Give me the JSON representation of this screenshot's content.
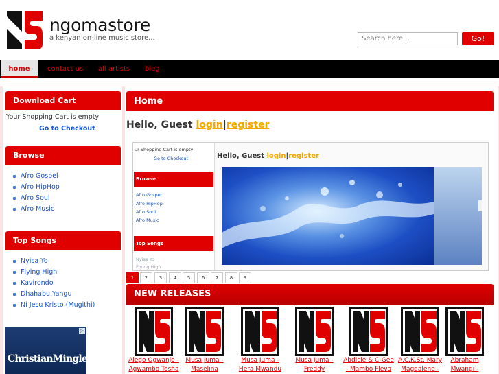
{
  "header": {
    "site_title": "ngomastore",
    "tagline": "a kenyan on-line music store...",
    "search_placeholder": "Search here...",
    "search_button": "Go!"
  },
  "nav": {
    "items": [
      "home",
      "contact us",
      "all artists",
      "blog"
    ],
    "active": "home"
  },
  "sidebar": {
    "cart": {
      "title": "Download Cart",
      "empty_text": "Your Shopping Cart is empty",
      "checkout_link": "Go to Checkout"
    },
    "browse": {
      "title": "Browse",
      "items": [
        "Afro Gospel",
        "Afro HipHop",
        "Afro Soul",
        "Afro Music"
      ]
    },
    "top_songs": {
      "title": "Top Songs",
      "items": [
        "Nyisa Yo",
        "Flying High",
        "Kavirondo",
        "Dhahabu Yangu",
        "Ni Jesu Kristo (Mugithi)"
      ]
    },
    "ad": {
      "text": "ChristianMingle",
      "badge": "▷"
    }
  },
  "main": {
    "title": "Home",
    "greeting_prefix": "Hello, Guest",
    "login_link": "login",
    "separator": "|",
    "register_link": "register",
    "slideshow": {
      "mini_cart_text": "ur Shopping Cart is empty",
      "mini_checkout": "Go to Checkout",
      "mini_browse": "Browse",
      "mini_browse_items": [
        "Afro Gospel",
        "Afro HipHop",
        "Afro Soul",
        "Afro Music"
      ],
      "mini_top_songs": "Top Songs",
      "mini_top_items": [
        "Nyisa Yo",
        "Flying High"
      ],
      "mini_greeting_prefix": "Hello, Guest",
      "mini_login": "login",
      "mini_register": "register"
    },
    "pager": {
      "pages": [
        "1",
        "2",
        "3",
        "4",
        "5",
        "6",
        "7",
        "8",
        "9"
      ],
      "active": "1"
    },
    "new_releases": {
      "title": "NEW RELEASES",
      "items": [
        {
          "line1": "Alego Ogwanjo -",
          "line2": "Agwambo Tosha"
        },
        {
          "line1": "Musa Juma -",
          "line2": "Maselina"
        },
        {
          "line1": "Musa Juma -",
          "line2": "Hera Mwandu"
        },
        {
          "line1": "Musa Juma -",
          "line2": "Freddy"
        },
        {
          "line1": "Abdicie & C-Gee",
          "line2": "- Mambo Fleva"
        },
        {
          "line1": "A.C.K.St. Mary",
          "line2": "Magdalene -"
        },
        {
          "line1": "Abraham",
          "line2": "Mwangi -"
        }
      ]
    }
  },
  "colors": {
    "brand_red": "#e00000",
    "link_blue": "#1a55c8",
    "link_orange": "#f7a800",
    "nav_bg": "#000000"
  }
}
